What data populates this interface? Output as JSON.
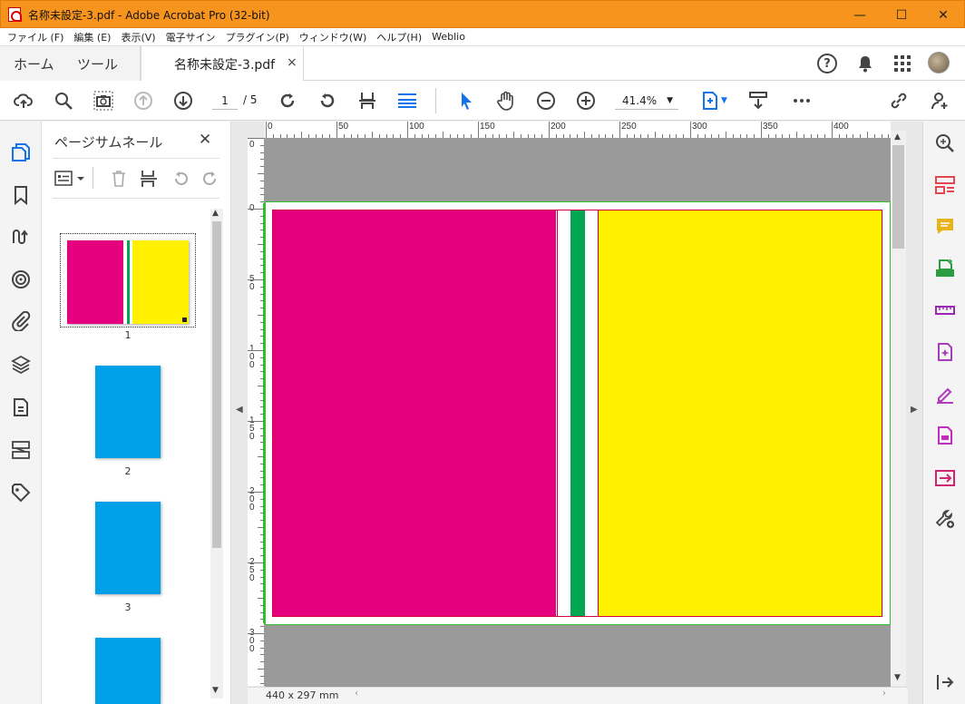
{
  "window": {
    "title": "名称未設定-3.pdf - Adobe Acrobat Pro (32-bit)",
    "minimize": "—",
    "maximize": "☐",
    "close": "✕"
  },
  "menu": [
    "ファイル (F)",
    "編集 (E)",
    "表示(V)",
    "電子サイン",
    "プラグイン(P)",
    "ウィンドウ(W)",
    "ヘルプ(H)",
    "Weblio"
  ],
  "tabs": {
    "home": "ホーム",
    "tools": "ツール",
    "document": "名称未設定-3.pdf",
    "close": "×"
  },
  "toolbar": {
    "current_page": "1",
    "total_pages": "/ 5",
    "zoom": "41.4%"
  },
  "thumbnails": {
    "title": "ページサムネール",
    "close": "✕",
    "pages": [
      "1",
      "2",
      "3"
    ]
  },
  "ruler": {
    "h_labels": [
      "0",
      "50",
      "100",
      "150",
      "200",
      "250",
      "300",
      "350",
      "400"
    ],
    "v_labels": [
      [
        "0"
      ],
      [
        "0"
      ],
      [
        "5",
        "0"
      ],
      [
        "1",
        "0",
        "0"
      ],
      [
        "1",
        "5",
        "0"
      ],
      [
        "2",
        "0",
        "0"
      ],
      [
        "2",
        "5",
        "0"
      ],
      [
        "3",
        "0",
        "0"
      ]
    ]
  },
  "status": {
    "page_size": "440 x 297 mm"
  },
  "colors": {
    "titlebar": "#f7941d",
    "magenta": "#e4007f",
    "yellow": "#fff100",
    "green": "#00a650",
    "thumb_blue": "#00a0e9",
    "accent": "#1473e6"
  }
}
